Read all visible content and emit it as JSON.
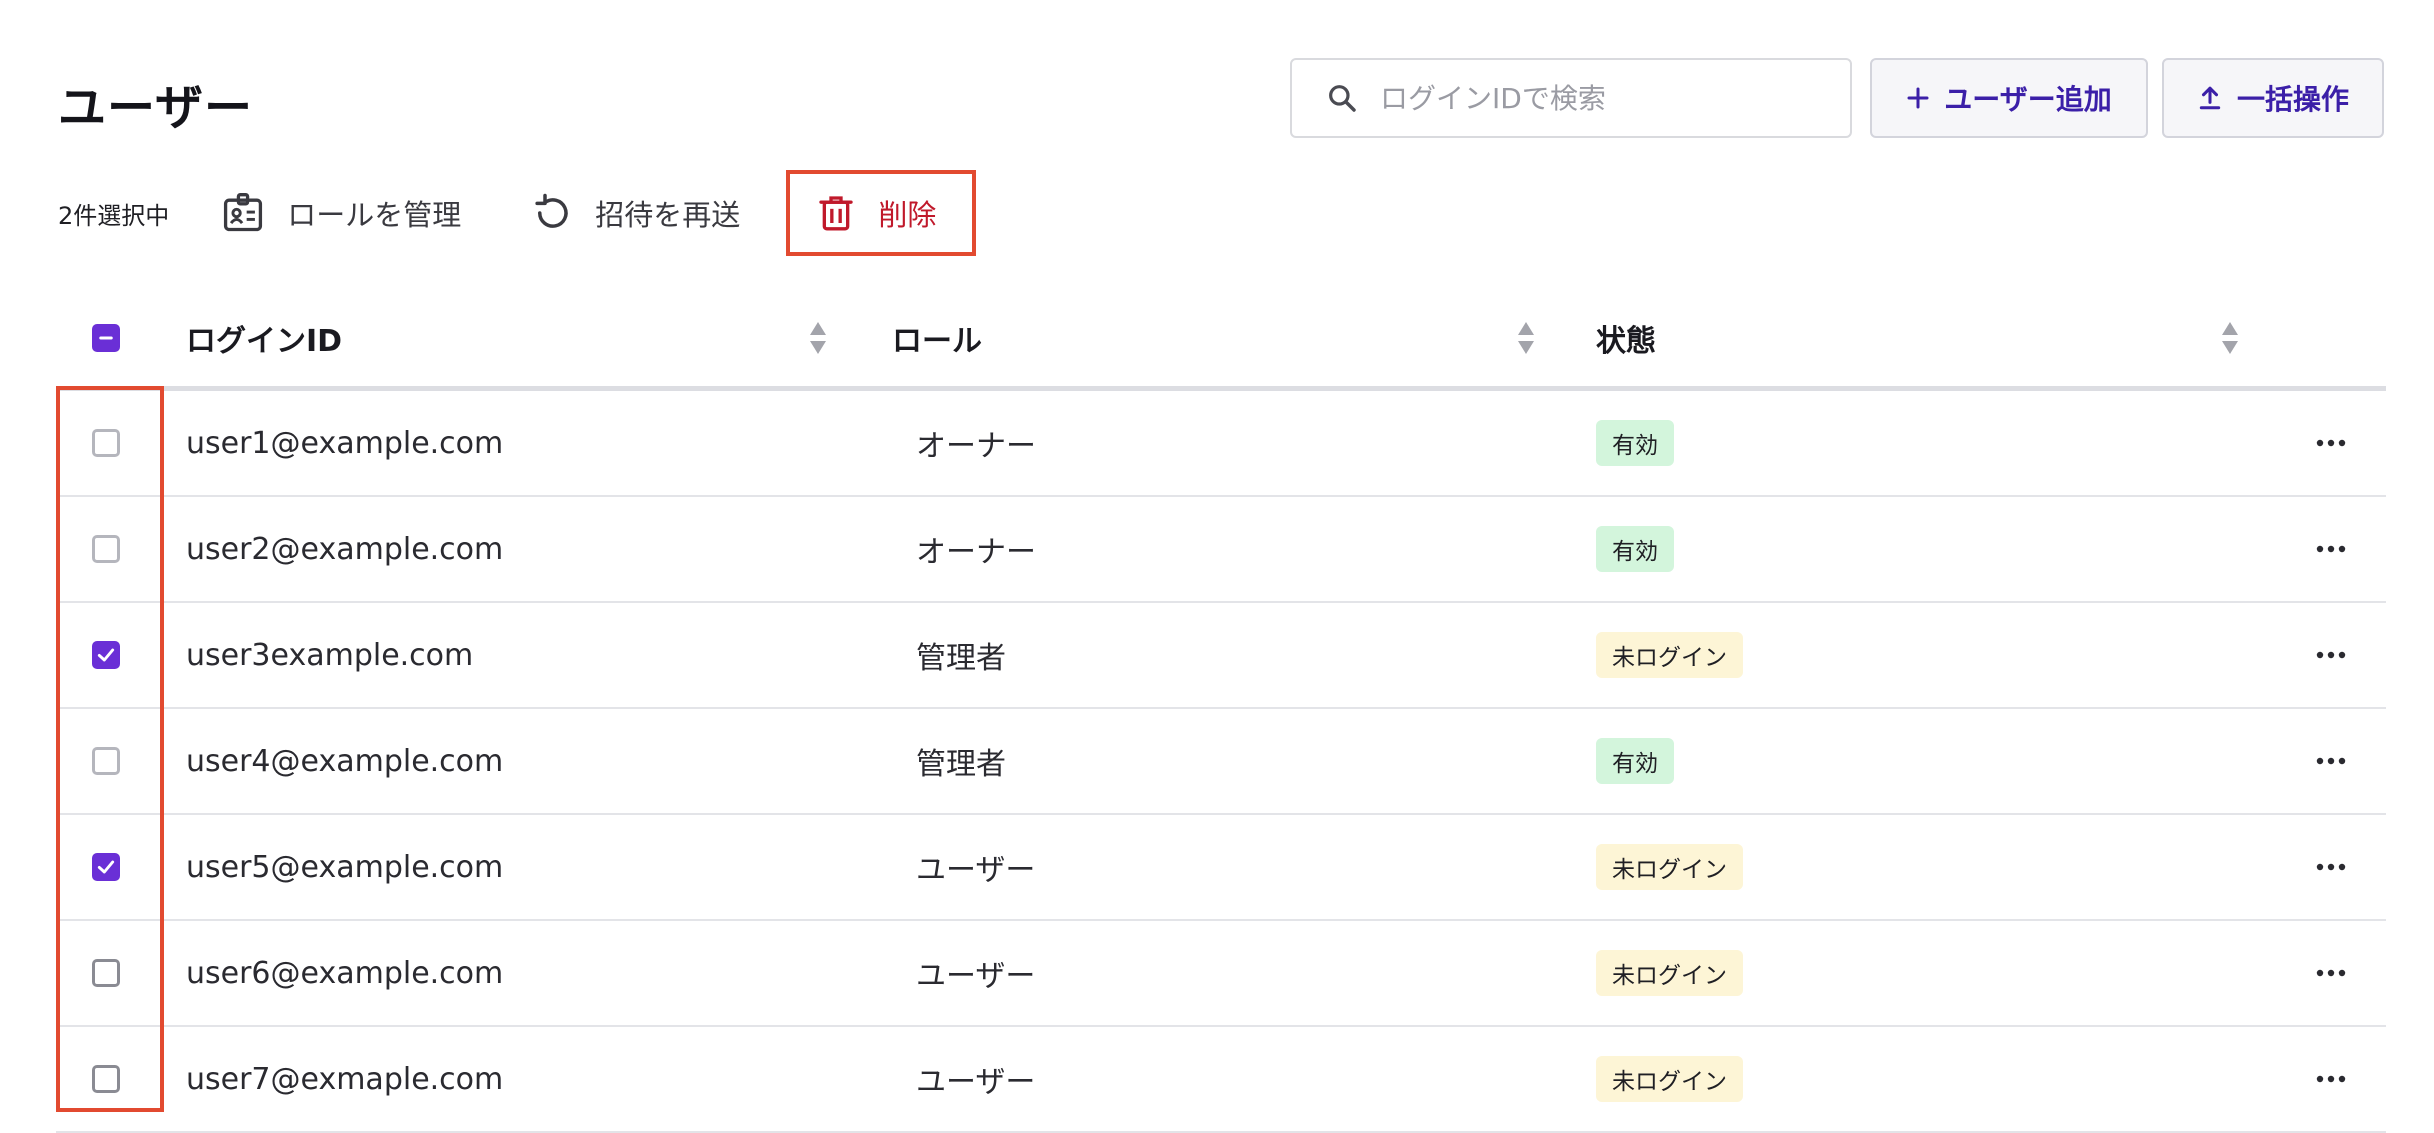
{
  "header": {
    "title": "ユーザー",
    "search_placeholder": "ログインIDで検索",
    "add_user_label": "ユーザー追加",
    "bulk_label": "一括操作"
  },
  "selection": {
    "count_label": "2件選択中",
    "manage_roles_label": "ロールを管理",
    "resend_invite_label": "招待を再送",
    "delete_label": "削除"
  },
  "table": {
    "columns": [
      "ログインID",
      "ロール",
      "状態"
    ],
    "rows": [
      {
        "login_id": "user1@example.com",
        "role": "オーナー",
        "status": "有効",
        "status_kind": "active",
        "checked": false
      },
      {
        "login_id": "user2@example.com",
        "role": "オーナー",
        "status": "有効",
        "status_kind": "active",
        "checked": false
      },
      {
        "login_id": "user3example.com",
        "role": "管理者",
        "status": "未ログイン",
        "status_kind": "pending",
        "checked": true
      },
      {
        "login_id": "user4@example.com",
        "role": "管理者",
        "status": "有効",
        "status_kind": "active",
        "checked": false
      },
      {
        "login_id": "user5@example.com",
        "role": "ユーザー",
        "status": "未ログイン",
        "status_kind": "pending",
        "checked": true
      },
      {
        "login_id": "user6@example.com",
        "role": "ユーザー",
        "status": "未ログイン",
        "status_kind": "pending",
        "checked": false
      },
      {
        "login_id": "user7@exmaple.com",
        "role": "ユーザー",
        "status": "未ログイン",
        "status_kind": "pending",
        "checked": false
      }
    ]
  },
  "colors": {
    "accent": "#6a2fd6",
    "primary_text": "#3b1fa8",
    "danger": "#c0192b",
    "highlight": "#e24a30",
    "badge_active_bg": "#d3f5dc",
    "badge_pending_bg": "#fdf5d6"
  },
  "icons": {
    "search": "search-icon",
    "add": "plus-icon",
    "bulk": "upload-icon",
    "manage_roles": "id-badge-icon",
    "resend": "refresh-icon",
    "delete": "trash-icon",
    "sort": "sort-icon",
    "row_menu": "more-horizontal-icon"
  }
}
